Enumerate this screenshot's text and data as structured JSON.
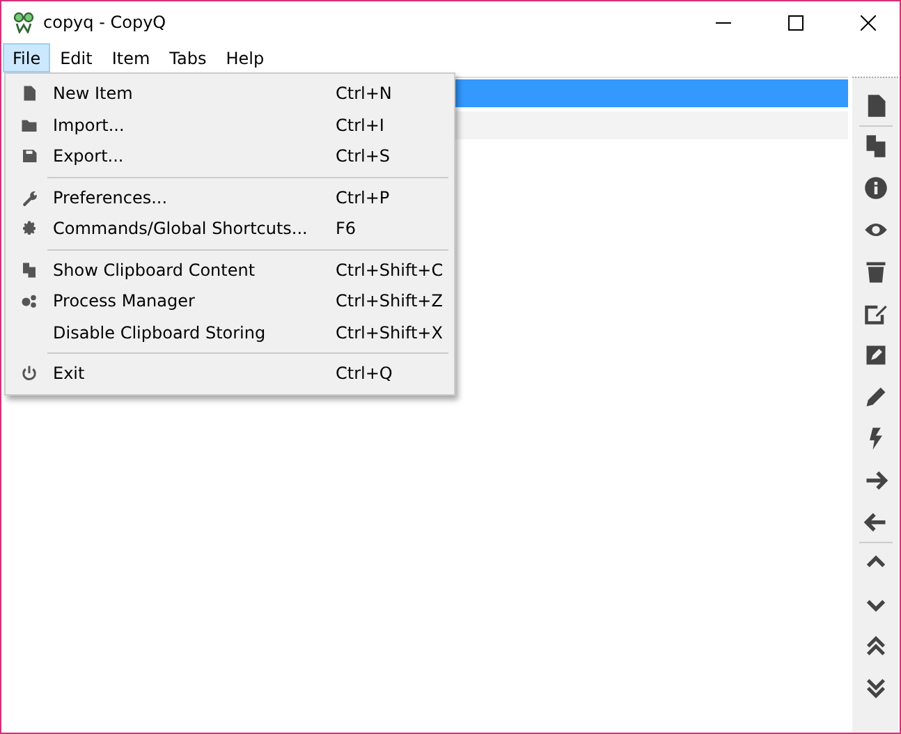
{
  "window": {
    "title": "copyq - CopyQ"
  },
  "menubar": [
    {
      "label": "File",
      "selected": true
    },
    {
      "label": "Edit",
      "selected": false
    },
    {
      "label": "Item",
      "selected": false
    },
    {
      "label": "Tabs",
      "selected": false
    },
    {
      "label": "Help",
      "selected": false
    }
  ],
  "file_menu": {
    "groups": [
      [
        {
          "label": "New Item",
          "shortcut": "Ctrl+N"
        },
        {
          "label": "Import...",
          "shortcut": "Ctrl+I"
        },
        {
          "label": "Export...",
          "shortcut": "Ctrl+S"
        }
      ],
      [
        {
          "label": "Preferences...",
          "shortcut": "Ctrl+P"
        },
        {
          "label": "Commands/Global Shortcuts...",
          "shortcut": "F6"
        }
      ],
      [
        {
          "label": "Show Clipboard Content",
          "shortcut": "Ctrl+Shift+C"
        },
        {
          "label": "Process Manager",
          "shortcut": "Ctrl+Shift+Z"
        },
        {
          "label": "Disable Clipboard Storing",
          "shortcut": "Ctrl+Shift+X"
        }
      ],
      [
        {
          "label": "Exit",
          "shortcut": "Ctrl+Q"
        }
      ]
    ]
  },
  "items": [
    {
      "selected": true
    },
    {
      "selected": false
    }
  ]
}
